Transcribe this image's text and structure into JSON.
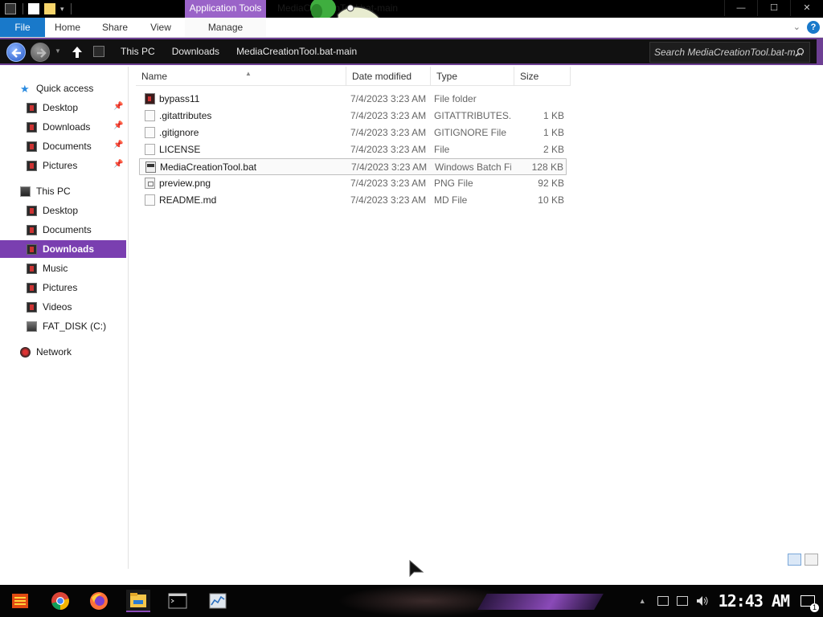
{
  "window": {
    "title": "MediaCreationTool.bat-main",
    "context_tab": "Application Tools"
  },
  "ribbon": {
    "tabs": [
      "File",
      "Home",
      "Share",
      "View",
      "Manage"
    ],
    "help_label": "?"
  },
  "nav": {
    "breadcrumbs": [
      "This PC",
      "Downloads",
      "MediaCreationTool.bat-main"
    ],
    "search_placeholder": "Search MediaCreationTool.bat-m..."
  },
  "sidebar": {
    "quick_access": {
      "label": "Quick access",
      "items": [
        "Desktop",
        "Downloads",
        "Documents",
        "Pictures"
      ]
    },
    "this_pc": {
      "label": "This PC",
      "items": [
        "Desktop",
        "Documents",
        "Downloads",
        "Music",
        "Pictures",
        "Videos",
        "FAT_DISK (C:)"
      ],
      "selected": "Downloads"
    },
    "network": {
      "label": "Network"
    }
  },
  "columns": {
    "name": "Name",
    "date": "Date modified",
    "type": "Type",
    "size": "Size"
  },
  "files": [
    {
      "name": "bypass11",
      "date": "7/4/2023 3:23 AM",
      "type": "File folder",
      "size": "",
      "icon": "folder-icon"
    },
    {
      "name": ".gitattributes",
      "date": "7/4/2023 3:23 AM",
      "type": "GITATTRIBUTES...",
      "size": "1 KB",
      "icon": "document-icon"
    },
    {
      "name": ".gitignore",
      "date": "7/4/2023 3:23 AM",
      "type": "GITIGNORE File",
      "size": "1 KB",
      "icon": "document-icon"
    },
    {
      "name": "LICENSE",
      "date": "7/4/2023 3:23 AM",
      "type": "File",
      "size": "2 KB",
      "icon": "document-icon"
    },
    {
      "name": "MediaCreationTool.bat",
      "date": "7/4/2023 3:23 AM",
      "type": "Windows Batch File",
      "size": "128 KB",
      "icon": "batch-file-icon",
      "selected": true
    },
    {
      "name": "preview.png",
      "date": "7/4/2023 3:23 AM",
      "type": "PNG File",
      "size": "92 KB",
      "icon": "image-file-icon"
    },
    {
      "name": "README.md",
      "date": "7/4/2023 3:23 AM",
      "type": "MD File",
      "size": "10 KB",
      "icon": "document-icon"
    }
  ],
  "taskbar": {
    "clock": "12:43 AM",
    "notification_count": "1",
    "apps": [
      "start-menu-icon",
      "chrome-icon",
      "firefox-icon",
      "file-explorer-icon",
      "command-prompt-icon",
      "resource-monitor-icon"
    ]
  },
  "colors": {
    "accent_purple": "#7a3fb0",
    "file_tab_blue": "#1979ca",
    "title_bar": "#000000"
  }
}
